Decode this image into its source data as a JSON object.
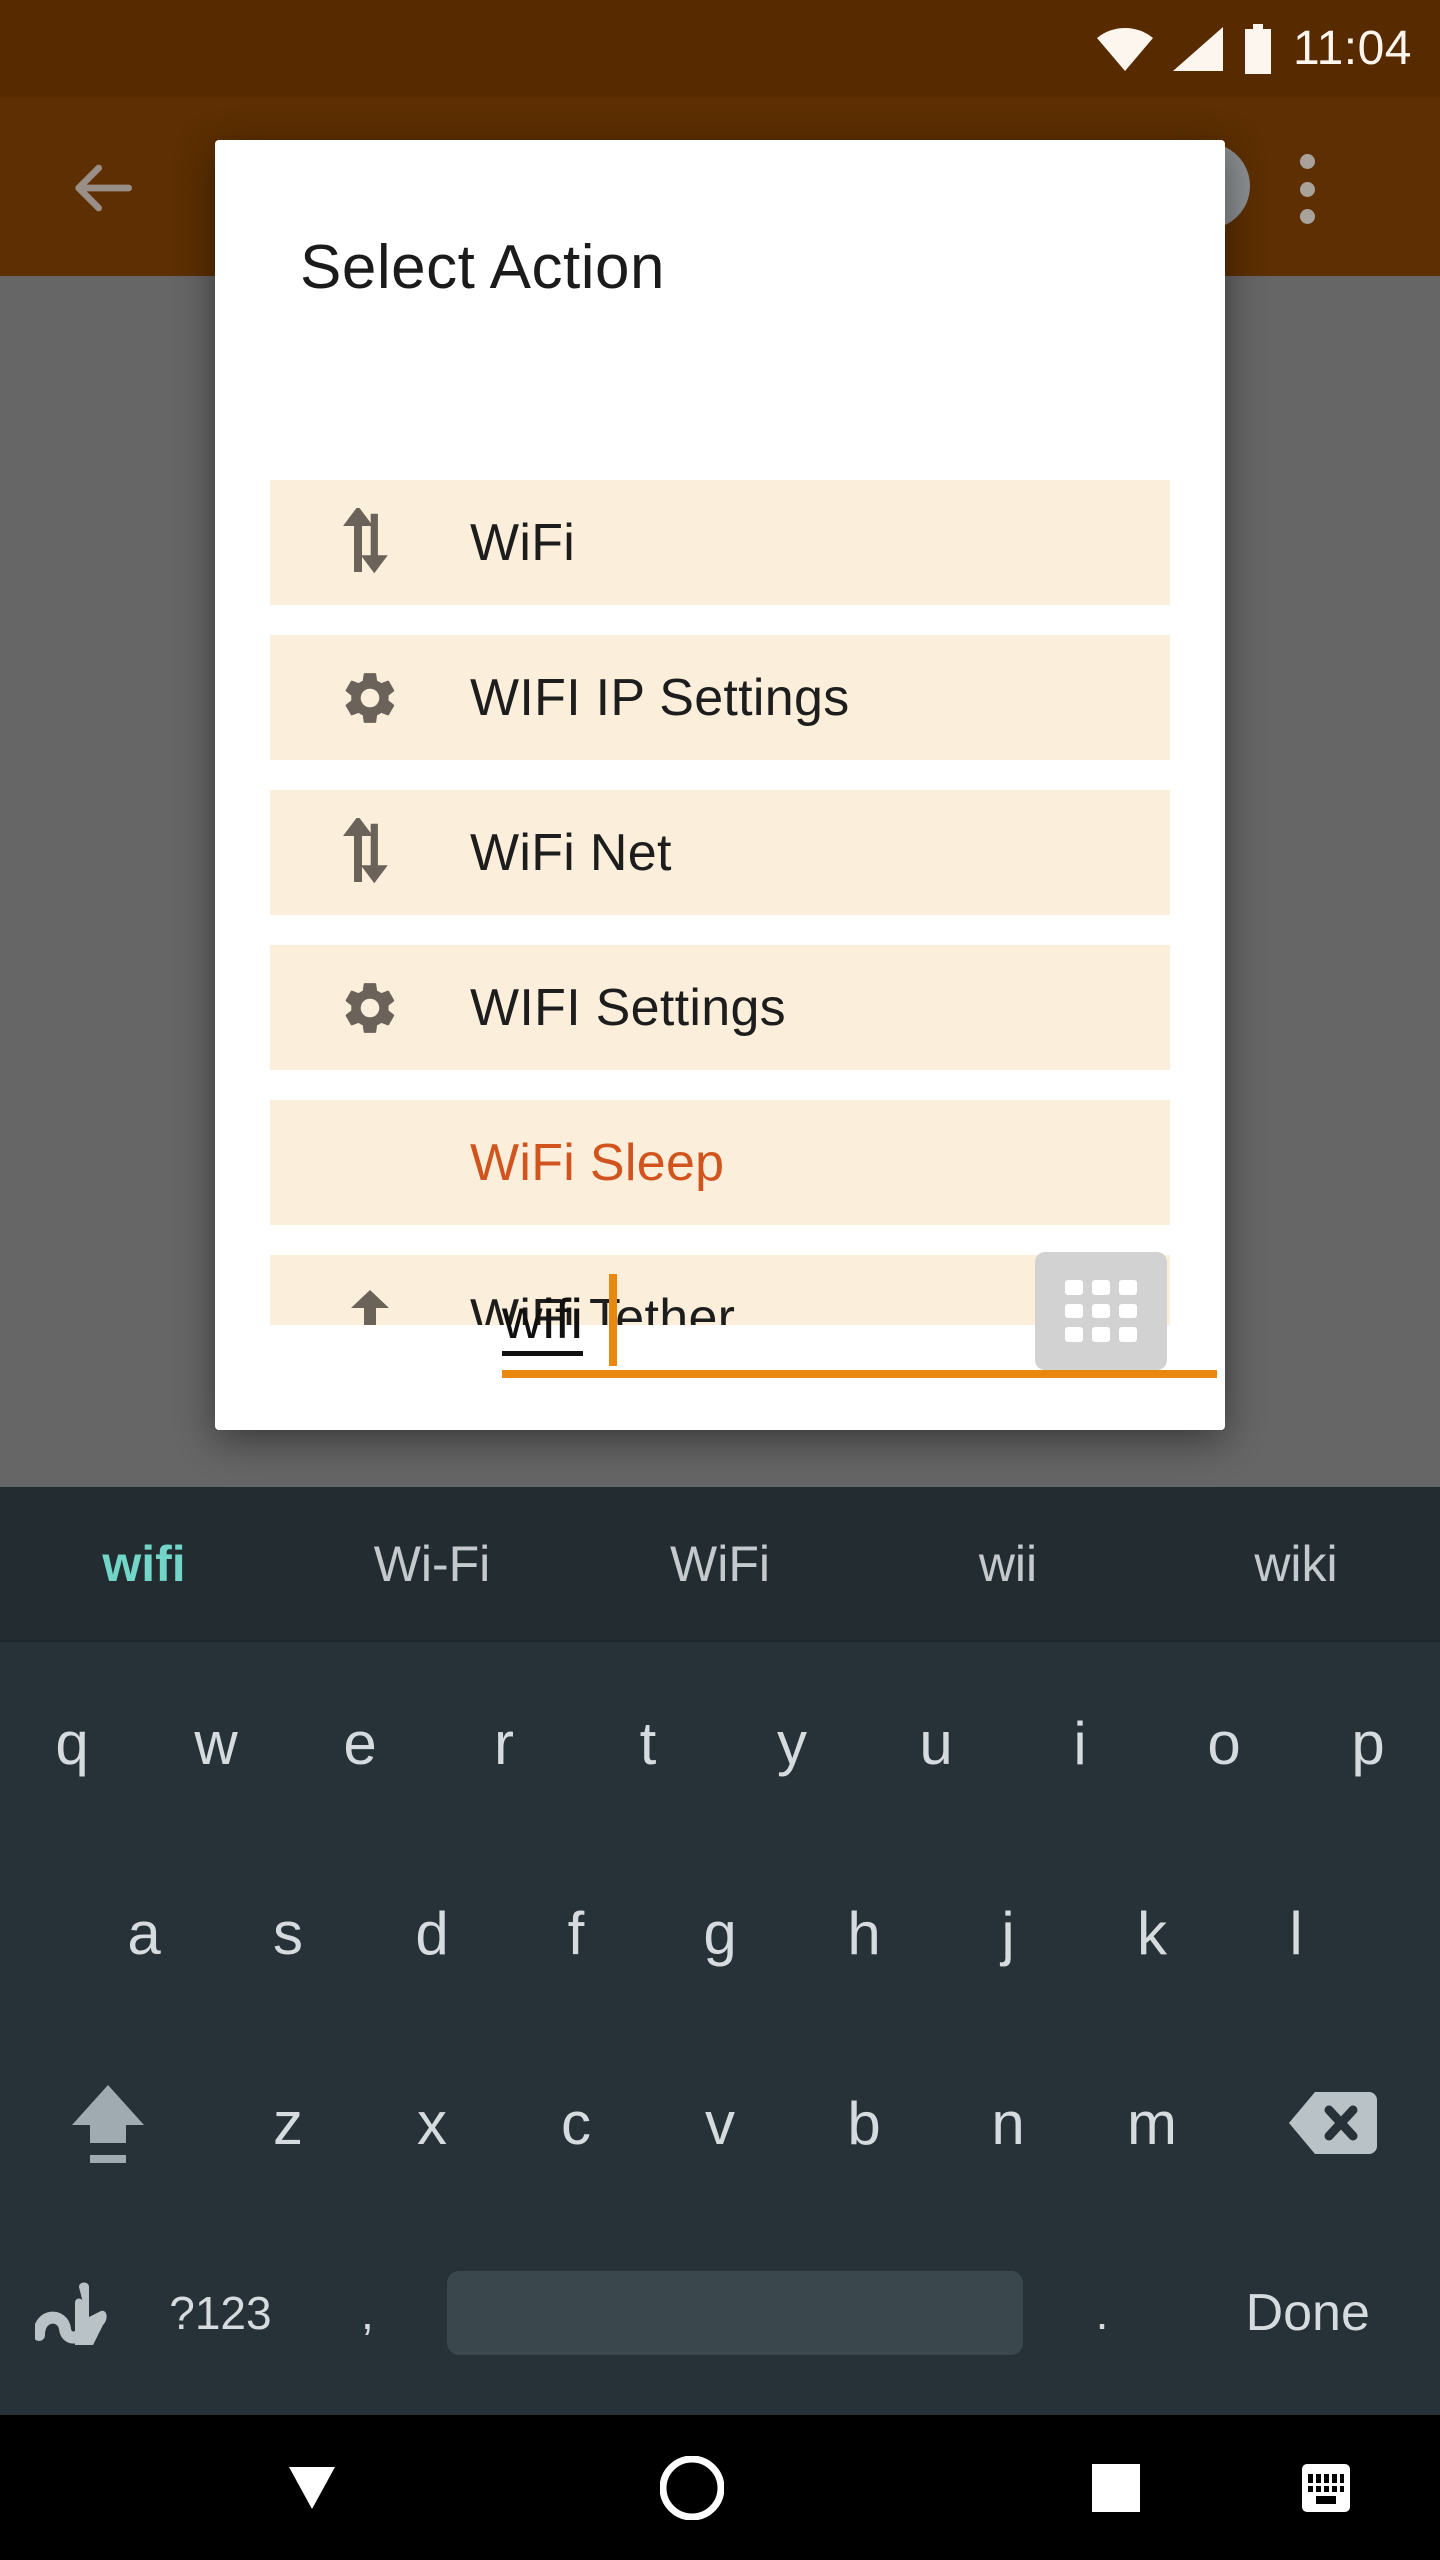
{
  "status_bar": {
    "time": "11:04",
    "icons": [
      "wifi-icon",
      "signal-icon",
      "battery-icon"
    ]
  },
  "app_toolbar": {
    "back_icon": "back-arrow-icon",
    "avatar_icon": "circle-icon",
    "overflow_icon": "overflow-menu-icon"
  },
  "dialog": {
    "title": "Select  Action",
    "items": [
      {
        "label": "WiFi",
        "icon": "up-down-arrows-icon",
        "accent": false
      },
      {
        "label": "WIFI IP Settings",
        "icon": "gear-icon",
        "accent": false
      },
      {
        "label": "WiFi Net",
        "icon": "up-down-arrows-icon",
        "accent": false
      },
      {
        "label": "WIFI Settings",
        "icon": "gear-icon",
        "accent": false
      },
      {
        "label": "WiFi Sleep",
        "icon": "none",
        "accent": true
      },
      {
        "label": "WiFi Tether",
        "icon": "up-arrow-icon",
        "accent": false
      }
    ],
    "input": {
      "value": "wifi",
      "placeholder": "",
      "grid_button_icon": "apps-grid-icon"
    },
    "colors": {
      "row_background": "#fbefdc",
      "accent": "#d1541f",
      "input_underline": "#e8880f"
    }
  },
  "keyboard": {
    "suggestions": [
      {
        "text": "wifi",
        "active": true
      },
      {
        "text": "Wi-Fi",
        "active": false
      },
      {
        "text": "WiFi",
        "active": false
      },
      {
        "text": "wii",
        "active": false
      },
      {
        "text": "wiki",
        "active": false
      }
    ],
    "row1": [
      "q",
      "w",
      "e",
      "r",
      "t",
      "y",
      "u",
      "i",
      "o",
      "p"
    ],
    "row2": [
      "a",
      "s",
      "d",
      "f",
      "g",
      "h",
      "j",
      "k",
      "l"
    ],
    "row3": [
      "z",
      "x",
      "c",
      "v",
      "b",
      "n",
      "m"
    ],
    "shift_icon": "shift-icon",
    "backspace_icon": "backspace-icon",
    "bottom": {
      "handwriting_icon": "handwriting-icon",
      "symbols_label": "?123",
      "comma_label": ",",
      "space_label": "",
      "period_label": ".",
      "action_label": "Done"
    },
    "colors": {
      "background": "#263238",
      "suggestion_active": "#72d5c8"
    }
  },
  "nav_bar": {
    "back_icon": "nav-back-down-icon",
    "home_icon": "nav-home-icon",
    "recents_icon": "nav-recents-icon",
    "keyboard_switch_icon": "nav-keyboard-icon"
  }
}
